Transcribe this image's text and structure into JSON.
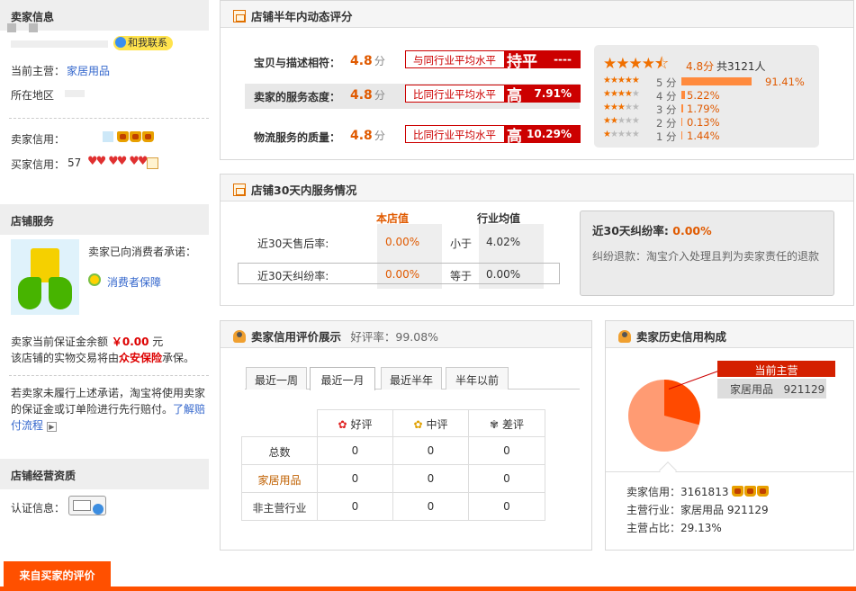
{
  "sidebar": {
    "seller_info": {
      "heading": "卖家信息",
      "contact_badge": "和我联系",
      "main_business_label": "当前主营：",
      "main_business_value": "家居用品",
      "location_label": "所在地区",
      "seller_credit_label": "卖家信用：",
      "buyer_credit_label": "买家信用：",
      "buyer_credit_value": "57"
    },
    "shop_service": {
      "heading": "店铺服务",
      "promise_text": "卖家已向消费者承诺：",
      "guarantee_link": "消费者保障",
      "deposit_prefix": "卖家当前保证金余额",
      "deposit_amount": "￥0.00",
      "deposit_unit": "元",
      "insurer_prefix": "该店铺的实物交易将由",
      "insurer_name": "众安保险",
      "insurer_suffix": "承保。",
      "breach_text": "若卖家未履行上述承诺，淘宝将使用卖家的保证金或订单险进行先行赔付。",
      "learn_more_link": "了解赔付流程"
    },
    "qualification": {
      "heading": "店铺经营资质",
      "cert_label": "认证信息："
    }
  },
  "dsr": {
    "title": "店铺半年内动态评分",
    "rows": [
      {
        "label": "宝贝与描述相符：",
        "score": "4.8",
        "unit": "分",
        "compare": "与同行业平均水平",
        "level": "持平",
        "pct": "----"
      },
      {
        "label": "卖家的服务态度：",
        "score": "4.8",
        "unit": "分",
        "compare": "比同行业平均水平",
        "level": "高",
        "pct": "7.91%"
      },
      {
        "label": "物流服务的质量：",
        "score": "4.8",
        "unit": "分",
        "compare": "比同行业平均水平",
        "level": "高",
        "pct": "10.29%"
      }
    ],
    "summary": {
      "score": "4.8分",
      "total": "共3121人",
      "rating": 4.5
    },
    "breakdown": [
      {
        "stars": 5,
        "label": "5 分",
        "pct": "91.41%",
        "value": 91.41
      },
      {
        "stars": 4,
        "label": "4 分",
        "pct": "5.22%",
        "value": 5.22
      },
      {
        "stars": 3,
        "label": "3 分",
        "pct": "1.79%",
        "value": 1.79
      },
      {
        "stars": 2,
        "label": "2 分",
        "pct": "0.13%",
        "value": 0.13
      },
      {
        "stars": 1,
        "label": "1 分",
        "pct": "1.44%",
        "value": 1.44
      }
    ]
  },
  "service30": {
    "title": "店铺30天内服务情况",
    "col_shop": "本店值",
    "col_industry": "行业均值",
    "rows": [
      {
        "label": "近30天售后率:",
        "shop": "0.00%",
        "relation": "小于",
        "industry": "4.02%"
      },
      {
        "label": "近30天纠纷率:",
        "shop": "0.00%",
        "relation": "等于",
        "industry": "0.00%"
      }
    ],
    "info_title": "近30天纠纷率:",
    "info_value": "0.00%",
    "info_desc": "纠纷退款：淘宝介入处理且判为卖家责任的退款"
  },
  "credit": {
    "title": "卖家信用评价展示",
    "good_rate": "好评率：99.08%",
    "tabs": [
      "最近一周",
      "最近一月",
      "最近半年",
      "半年以前"
    ],
    "active_tab": 1,
    "col_good": "好评",
    "col_mid": "中评",
    "col_bad": "差评",
    "rows": [
      {
        "label": "总数",
        "good": "0",
        "mid": "0",
        "bad": "0"
      },
      {
        "label": "家居用品",
        "good": "0",
        "mid": "0",
        "bad": "0"
      },
      {
        "label": "非主营行业",
        "good": "0",
        "mid": "0",
        "bad": "0"
      }
    ]
  },
  "history": {
    "title": "卖家历史信用构成",
    "callout_title": "当前主营",
    "callout_name": "家居用品",
    "callout_value": "921129",
    "seller_credit_label": "卖家信用：",
    "seller_credit_value": "3161813",
    "main_industry_label": "主营行业：",
    "main_industry_value": "家居用品 921129",
    "main_ratio_label": "主营占比：",
    "main_ratio_value": "29.13%",
    "main_fraction": 0.2913,
    "colors": {
      "main": "#ff4a00",
      "rest": "#ff9b73"
    }
  },
  "bottom_tab": "来自买家的评价"
}
